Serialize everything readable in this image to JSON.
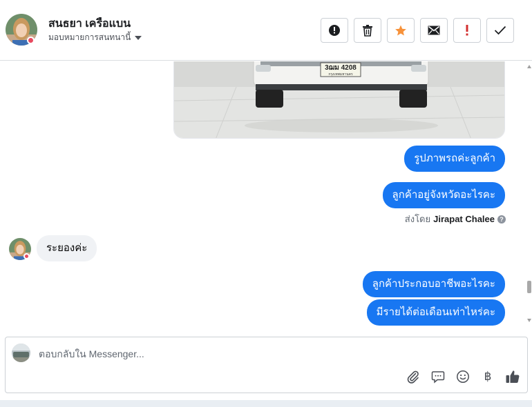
{
  "header": {
    "contact_name": "สนธยา เครือแบน",
    "assign_label": "มอบหมายการสนทนานี้",
    "actions": [
      {
        "name": "report-icon"
      },
      {
        "name": "trash-icon"
      },
      {
        "name": "star-icon"
      },
      {
        "name": "mail-icon"
      },
      {
        "name": "exclamation-icon"
      },
      {
        "name": "check-icon"
      }
    ]
  },
  "car_image": {
    "plate_text": "3ฌม 4208",
    "plate_sub": "กรุงเทพมหานคร"
  },
  "messages": [
    {
      "text": "รูปภาพรถค่ะลูกค้า",
      "direction": "out"
    },
    {
      "text": "ลูกค้าอยู่จังหวัดอะไรคะ",
      "direction": "out"
    },
    {
      "text": "ระยองค่ะ",
      "direction": "in"
    },
    {
      "text": "ลูกค้าประกอบอาชีพอะไรคะ",
      "direction": "out"
    },
    {
      "text": "มีรายได้ต่อเดือนเท่าไหร่คะ",
      "direction": "out"
    }
  ],
  "sent_by": {
    "prefix": "ส่งโดย",
    "name": "Jirapat Chalee",
    "help": "?"
  },
  "composer": {
    "placeholder": "ตอบกลับใน Messenger...",
    "value": "",
    "baht_symbol": "฿"
  },
  "colors": {
    "accent": "#1877f2",
    "star": "#f7923a",
    "alert": "#e0245e"
  }
}
